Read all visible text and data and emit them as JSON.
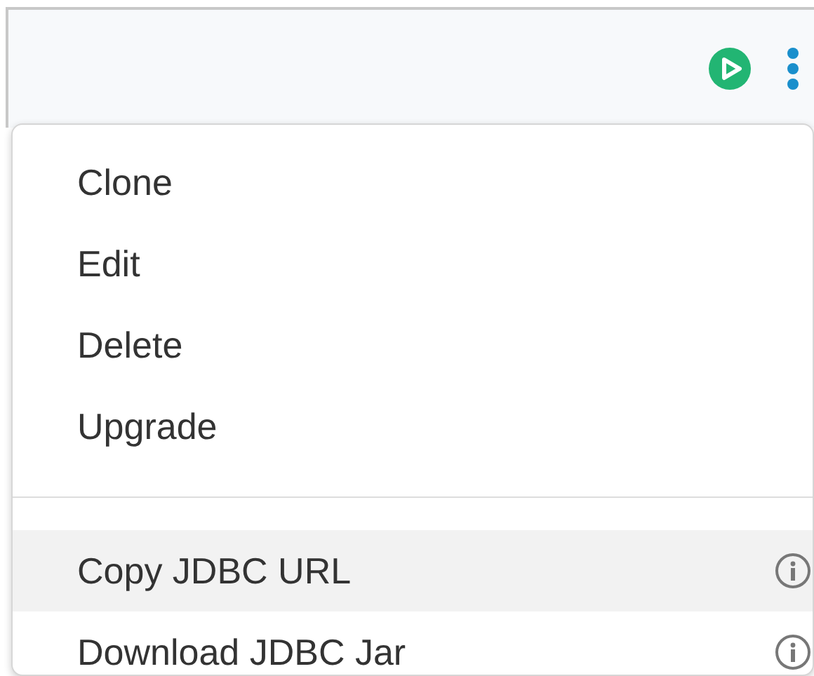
{
  "menu": {
    "sections": [
      {
        "items": [
          {
            "label": "Clone",
            "kind": "plain",
            "highlighted": false
          },
          {
            "label": "Edit",
            "kind": "plain",
            "highlighted": false
          },
          {
            "label": "Delete",
            "kind": "plain",
            "highlighted": false
          },
          {
            "label": "Upgrade",
            "kind": "plain",
            "highlighted": false
          }
        ]
      },
      {
        "items": [
          {
            "label": "Copy JDBC URL",
            "kind": "info",
            "highlighted": true
          },
          {
            "label": "Download JDBC Jar",
            "kind": "info",
            "highlighted": false
          }
        ]
      }
    ]
  }
}
